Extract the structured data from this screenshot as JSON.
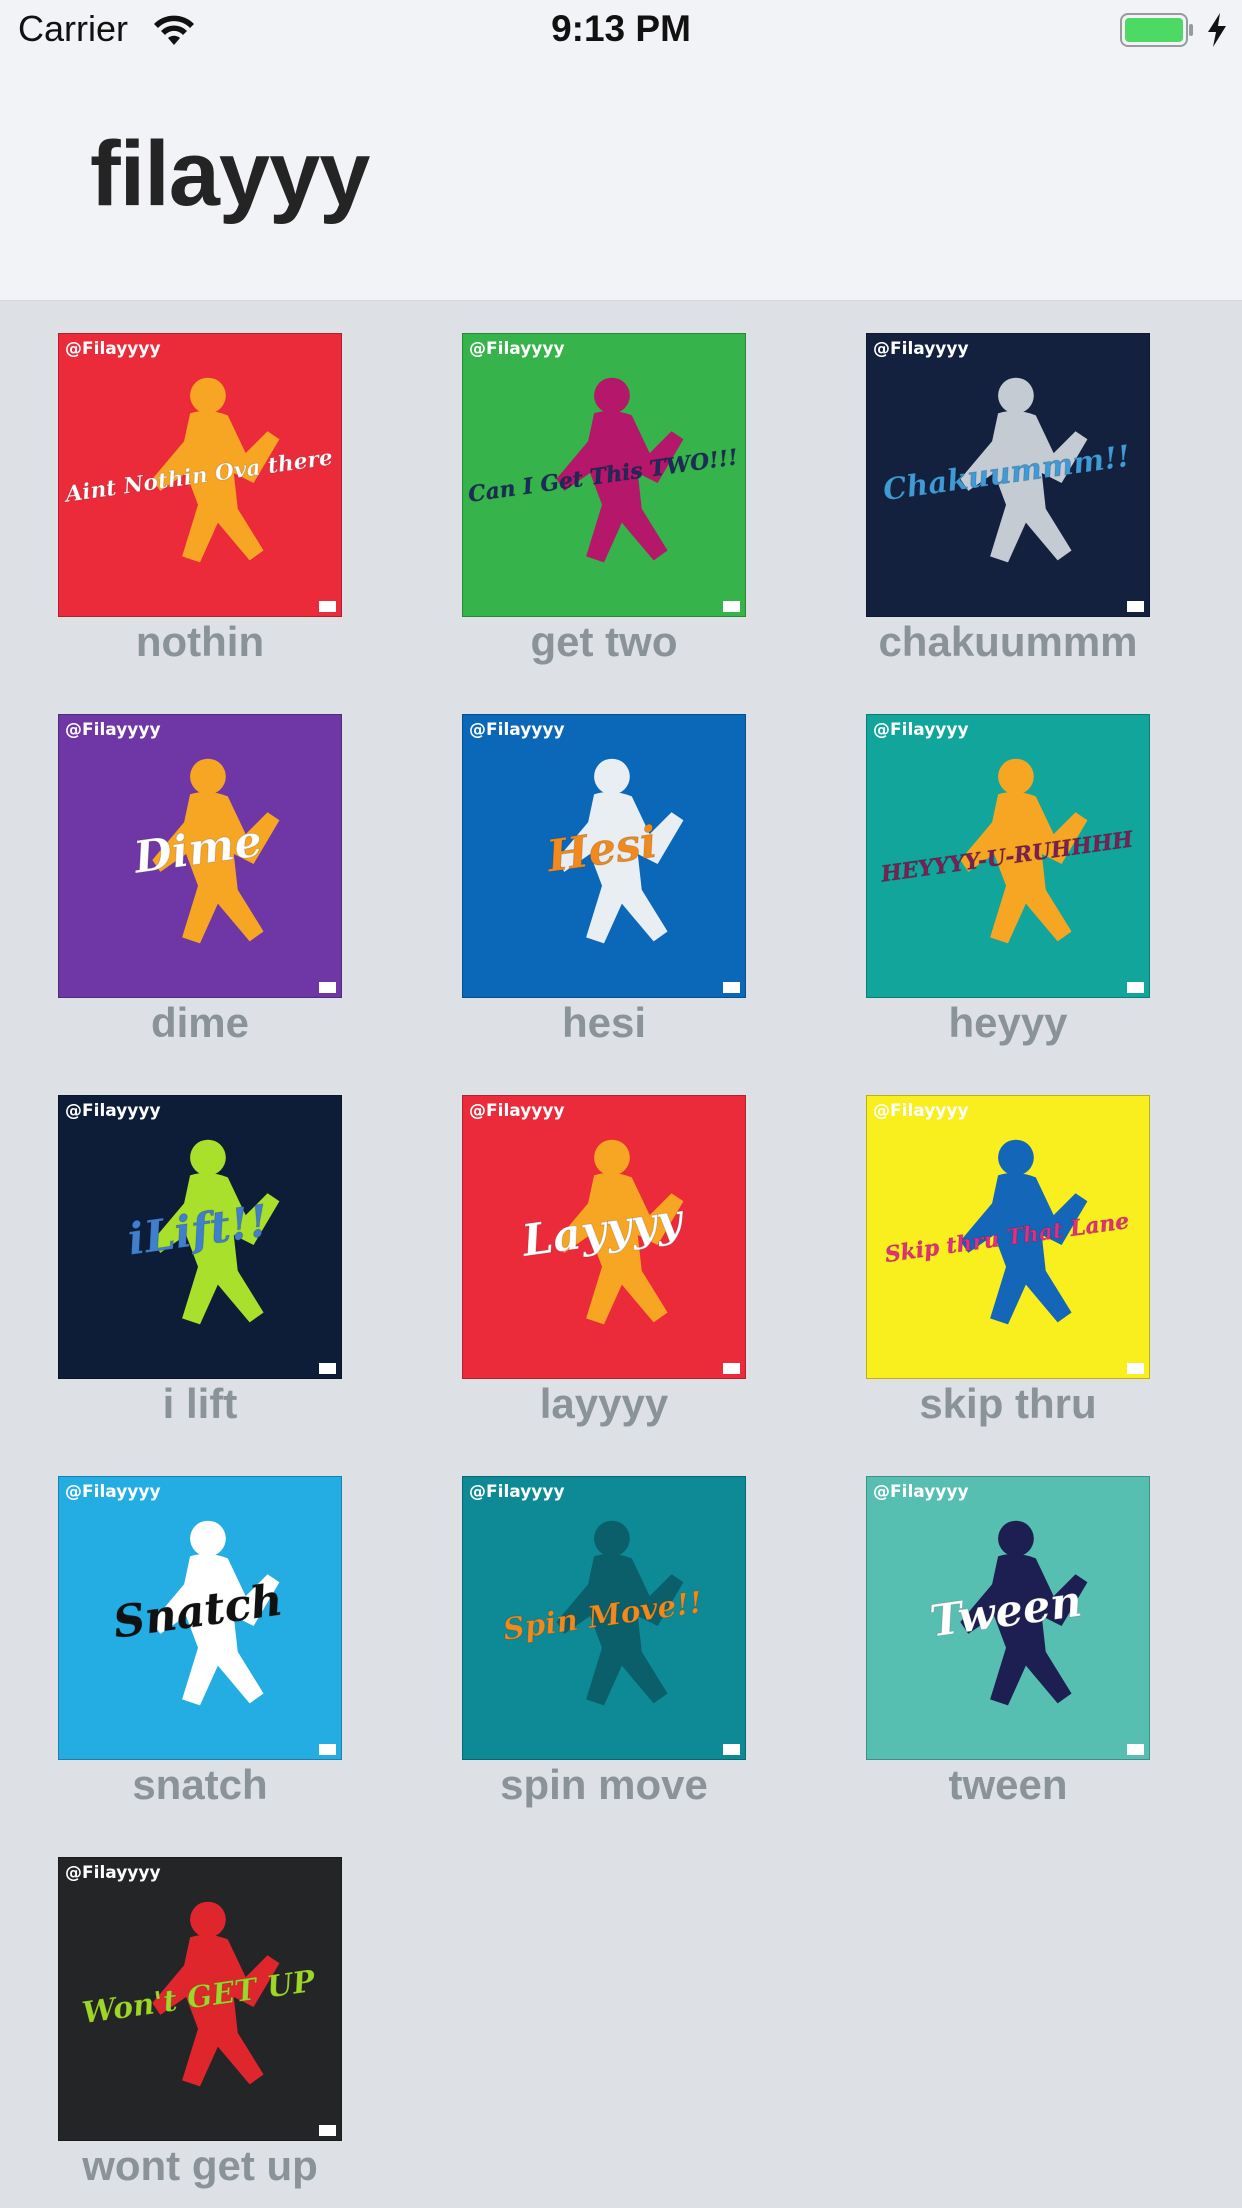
{
  "status_bar": {
    "carrier": "Carrier",
    "time": "9:13 PM",
    "icons": [
      "wifi-icon",
      "battery-icon",
      "charging-bolt-icon"
    ]
  },
  "nav": {
    "title": "filayyy"
  },
  "colors": {
    "header_bg": "#f2f3f6",
    "grid_bg": "#dde1e6",
    "label": "#8a9398",
    "battery": "#4cd964"
  },
  "stickers": [
    {
      "id": "nothin",
      "label": "nothin",
      "handle": "@Filayyyy",
      "bg": "#ec2b3a",
      "fg": "#ffffff",
      "accent": "#f6a623",
      "art_text": "Aint Nothin Ova there"
    },
    {
      "id": "get-two",
      "label": "get two",
      "handle": "@Filayyyy",
      "bg": "#36b34a",
      "fg": "#1d2a5c",
      "accent": "#b5176b",
      "art_text": "Can I Get This TWO!!!"
    },
    {
      "id": "chakuummm",
      "label": "chakuummm",
      "handle": "@Filayyyy",
      "bg": "#13213f",
      "fg": "#3f9ad6",
      "accent": "#c5cbd3",
      "art_text": "Chakuummm!!"
    },
    {
      "id": "dime",
      "label": "dime",
      "handle": "@Filayyyy",
      "bg": "#6f37a6",
      "fg": "#ffffff",
      "accent": "#f6a623",
      "art_text": "Dime"
    },
    {
      "id": "hesi",
      "label": "hesi",
      "handle": "@Filayyyy",
      "bg": "#0b68b9",
      "fg": "#f08a1e",
      "accent": "#e9eef3",
      "art_text": "Hesi"
    },
    {
      "id": "heyyy",
      "label": "heyyy",
      "handle": "@Filayyyy",
      "bg": "#11a59b",
      "fg": "#7d1f52",
      "accent": "#f6a623",
      "art_text": "HEYYYY-U-RUHHHH"
    },
    {
      "id": "i-lift",
      "label": "i lift",
      "handle": "@Filayyyy",
      "bg": "#0d1d38",
      "fg": "#3f7fcb",
      "accent": "#a8e02b",
      "art_text": "iLift!!"
    },
    {
      "id": "layyyy",
      "label": "layyyy",
      "handle": "@Filayyyy",
      "bg": "#ec2b3a",
      "fg": "#ffffff",
      "accent": "#f6a623",
      "art_text": "Layyyy"
    },
    {
      "id": "skip-thru",
      "label": "skip thru",
      "handle": "@Filayyyy",
      "bg": "#f9ee1e",
      "fg": "#e52d82",
      "accent": "#1466b8",
      "art_text": "Skip thru That Lane"
    },
    {
      "id": "snatch",
      "label": "snatch",
      "handle": "@Filayyyy",
      "bg": "#24ade3",
      "fg": "#111111",
      "accent": "#ffffff",
      "art_text": "Snatch"
    },
    {
      "id": "spin-move",
      "label": "spin move",
      "handle": "@Filayyyy",
      "bg": "#0d8a96",
      "fg": "#f08a1e",
      "accent": "#0a5f6a",
      "art_text": "Spin Move!!"
    },
    {
      "id": "tween",
      "label": "tween",
      "handle": "@Filayyyy",
      "bg": "#57bfb1",
      "fg": "#ffffff",
      "accent": "#1d1f52",
      "art_text": "Tween"
    },
    {
      "id": "wont-get-up",
      "label": "wont get up",
      "handle": "@Filayyyy",
      "bg": "#242526",
      "fg": "#9ed62a",
      "accent": "#e0262d",
      "art_text": "Won't GET UP"
    }
  ]
}
